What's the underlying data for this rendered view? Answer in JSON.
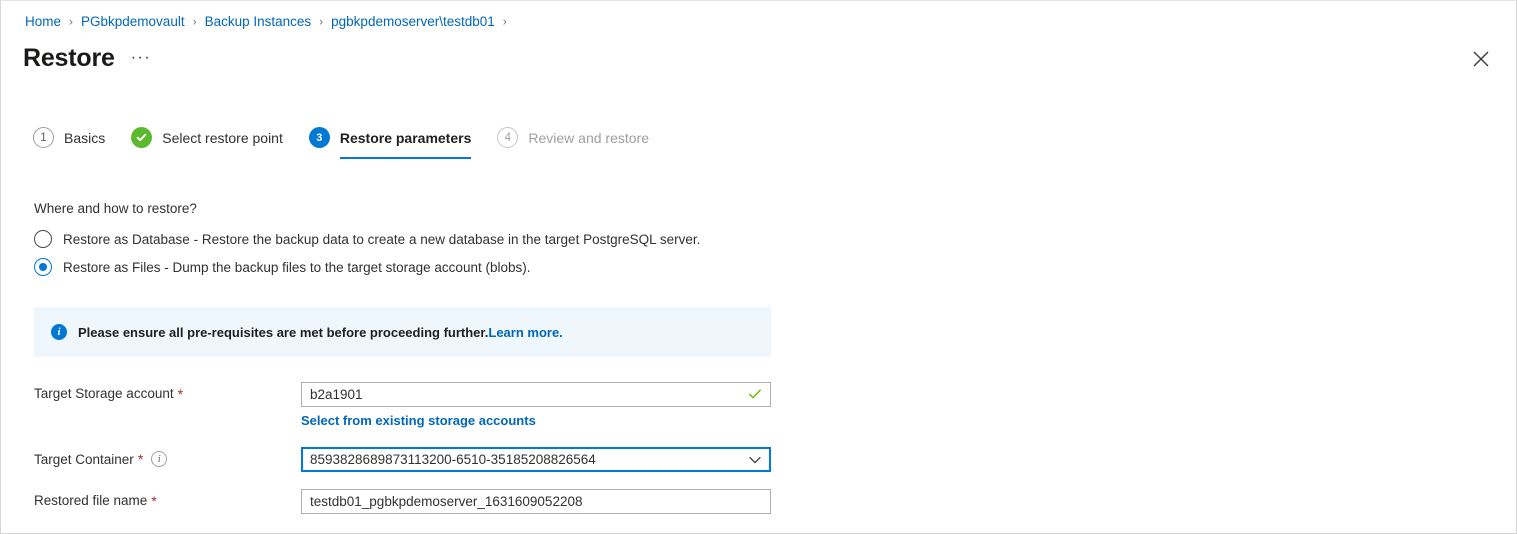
{
  "breadcrumb": {
    "items": [
      {
        "label": "Home"
      },
      {
        "label": "PGbkpdemovault"
      },
      {
        "label": "Backup Instances"
      },
      {
        "label": "pgbkpdemoserver\\testdb01"
      }
    ],
    "separator": "›"
  },
  "header": {
    "title": "Restore",
    "more_menu": "···",
    "close_icon": "close-icon"
  },
  "wizard": {
    "steps": [
      {
        "badge": "1",
        "label": "Basics",
        "state": "pending"
      },
      {
        "badge": "✓",
        "label": "Select restore point",
        "state": "done"
      },
      {
        "badge": "3",
        "label": "Restore parameters",
        "state": "current"
      },
      {
        "badge": "4",
        "label": "Review and restore",
        "state": "disabled"
      }
    ]
  },
  "main": {
    "section_label": "Where and how to restore?",
    "restore_mode": {
      "options": [
        {
          "label": "Restore as Database - Restore the backup data to create a new database in the target PostgreSQL server.",
          "selected": false
        },
        {
          "label": "Restore as Files - Dump the backup files to the target storage account (blobs).",
          "selected": true
        }
      ]
    },
    "info_banner": {
      "icon": "info-icon",
      "text": "Please ensure all pre-requisites are met before proceeding further.",
      "link_text": "Learn more."
    },
    "fields": {
      "storage_account": {
        "label": "Target Storage account",
        "required_marker": "*",
        "value": "b2a1901",
        "placeholder": "",
        "validation_icon": "checkmark-icon",
        "link_text": "Select from existing storage accounts"
      },
      "container": {
        "label": "Target Container",
        "required_marker": "*",
        "info_icon": "i",
        "value": "8593828689873113200-6510-35185208826564",
        "placeholder": "",
        "dropdown_icon": "chevron-down-icon"
      },
      "restored_file_name": {
        "label": "Restored file name",
        "required_marker": "*",
        "value": "testdb01_pgbkpdemoserver_1631609052208",
        "placeholder": ""
      }
    }
  },
  "colors": {
    "accent": "#0078d4",
    "link": "#0067b8",
    "success": "#5cb82e",
    "required": "#a4262c",
    "info_bg": "#eff6fc"
  }
}
